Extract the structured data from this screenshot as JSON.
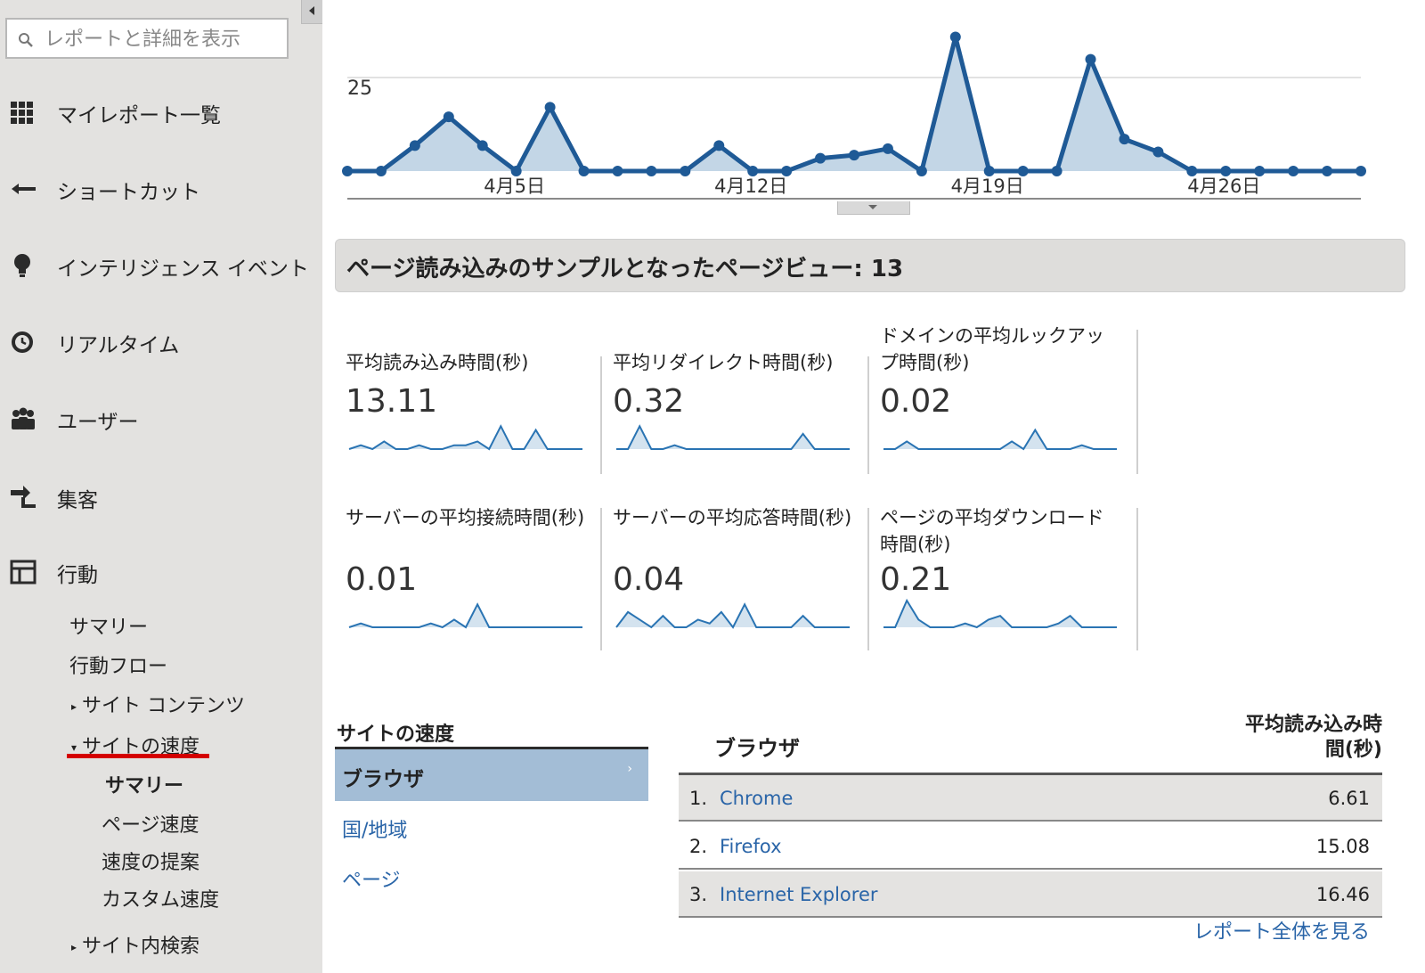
{
  "sidebar": {
    "search_placeholder": "レポートと詳細を表示",
    "nav": [
      {
        "label": "マイレポート一覧",
        "icon": "grid-icon"
      },
      {
        "label": "ショートカット",
        "icon": "shortcut-arrow-icon"
      },
      {
        "label": "インテリジェンス イベント",
        "icon": "lightbulb-icon"
      },
      {
        "label": "リアルタイム",
        "icon": "clock-icon"
      },
      {
        "label": "ユーザー",
        "icon": "users-icon"
      },
      {
        "label": "集客",
        "icon": "acquisition-icon"
      },
      {
        "label": "行動",
        "icon": "behavior-icon"
      }
    ],
    "behavior_sub": {
      "summary": "サマリー",
      "flow": "行動フロー",
      "site_content": "サイト コンテンツ",
      "site_speed": "サイトの速度",
      "speed_summary": "サマリー",
      "page_speed": "ページ速度",
      "speed_suggestions": "速度の提案",
      "custom_speed": "カスタム速度",
      "site_search": "サイト内検索"
    }
  },
  "overview": {
    "y_tick_label": "25",
    "colors": {
      "line": "#1f5a96",
      "fill": "#c3d6e6"
    }
  },
  "chart_data": [
    {
      "type": "area",
      "title": "",
      "x_tick_labels": [
        "4月5日",
        "4月12日",
        "4月19日",
        "4月26日"
      ],
      "ytick": 25,
      "ylim": [
        0,
        48
      ],
      "x": [
        "3月31日",
        "4月1日",
        "4月2日",
        "4月3日",
        "4月4日",
        "4月5日",
        "4月6日",
        "4月7日",
        "4月8日",
        "4月9日",
        "4月10日",
        "4月11日",
        "4月12日",
        "4月13日",
        "4月14日",
        "4月15日",
        "4月16日",
        "4月17日",
        "4月18日",
        "4月19日",
        "4月20日",
        "4月21日",
        "4月22日",
        "4月23日",
        "4月24日",
        "4月25日",
        "4月26日",
        "4月27日",
        "4月28日",
        "4月29日",
        "4月30日"
      ],
      "values": [
        0,
        0,
        8,
        17,
        8,
        0,
        20,
        0,
        0,
        0,
        0,
        8,
        0,
        0,
        4,
        5,
        7,
        0,
        42,
        0,
        0,
        0,
        35,
        10,
        6,
        0,
        0,
        0,
        0,
        0,
        0
      ]
    }
  ],
  "samples": {
    "text": "ページ読み込みのサンプルとなったページビュー: 13"
  },
  "metrics": [
    {
      "label": "平均読み込み時間(秒)",
      "value": "13.11",
      "spark": [
        0,
        1,
        0,
        2,
        0,
        0,
        1,
        0,
        0,
        1,
        1,
        2,
        0,
        6,
        0,
        0,
        5,
        0,
        0,
        0,
        0
      ]
    },
    {
      "label": "平均リダイレクト時間(秒)",
      "value": "0.32",
      "spark": [
        0,
        0,
        6,
        0,
        0,
        1,
        0,
        0,
        0,
        0,
        0,
        0,
        0,
        0,
        0,
        0,
        4,
        0,
        0,
        0,
        0
      ]
    },
    {
      "label": "ドメインの平均ルックアップ時間(秒)",
      "value": "0.02",
      "spark": [
        0,
        0,
        2,
        0,
        0,
        0,
        0,
        0,
        0,
        0,
        0,
        2,
        0,
        5,
        0,
        0,
        0,
        1,
        0,
        0,
        0
      ]
    },
    {
      "label": "サーバーの平均接続時間(秒)",
      "value": "0.01",
      "spark": [
        0,
        1,
        0,
        0,
        0,
        0,
        0,
        1,
        0,
        2,
        0,
        6,
        0,
        0,
        0,
        0,
        0,
        0,
        0,
        0,
        0
      ]
    },
    {
      "label": "サーバーの平均応答時間(秒)",
      "value": "0.04",
      "spark": [
        0,
        4,
        2,
        0,
        3,
        0,
        0,
        2,
        1,
        4,
        0,
        6,
        0,
        0,
        0,
        0,
        3,
        0,
        0,
        0,
        0
      ]
    },
    {
      "label": "ページの平均ダウンロード時間(秒)",
      "value": "0.21",
      "spark": [
        0,
        0,
        7,
        2,
        0,
        0,
        0,
        1,
        0,
        2,
        3,
        0,
        0,
        0,
        0,
        1,
        3,
        0,
        0,
        0,
        0
      ]
    }
  ],
  "dimensions": {
    "title": "サイトの速度",
    "selected": "ブラウザ",
    "selected_arrow": "›",
    "links": [
      "国/地域",
      "ページ"
    ]
  },
  "table": {
    "col_browser": "ブラウザ",
    "col_metric_line1": "平均読み込み時",
    "col_metric_line2": "間(秒)",
    "rows": [
      {
        "num": "1.",
        "name": "Chrome",
        "value": "6.61"
      },
      {
        "num": "2.",
        "name": "Firefox",
        "value": "15.08"
      },
      {
        "num": "3.",
        "name": "Internet Explorer",
        "value": "16.46"
      }
    ],
    "full_report": "レポート全体を見る"
  }
}
